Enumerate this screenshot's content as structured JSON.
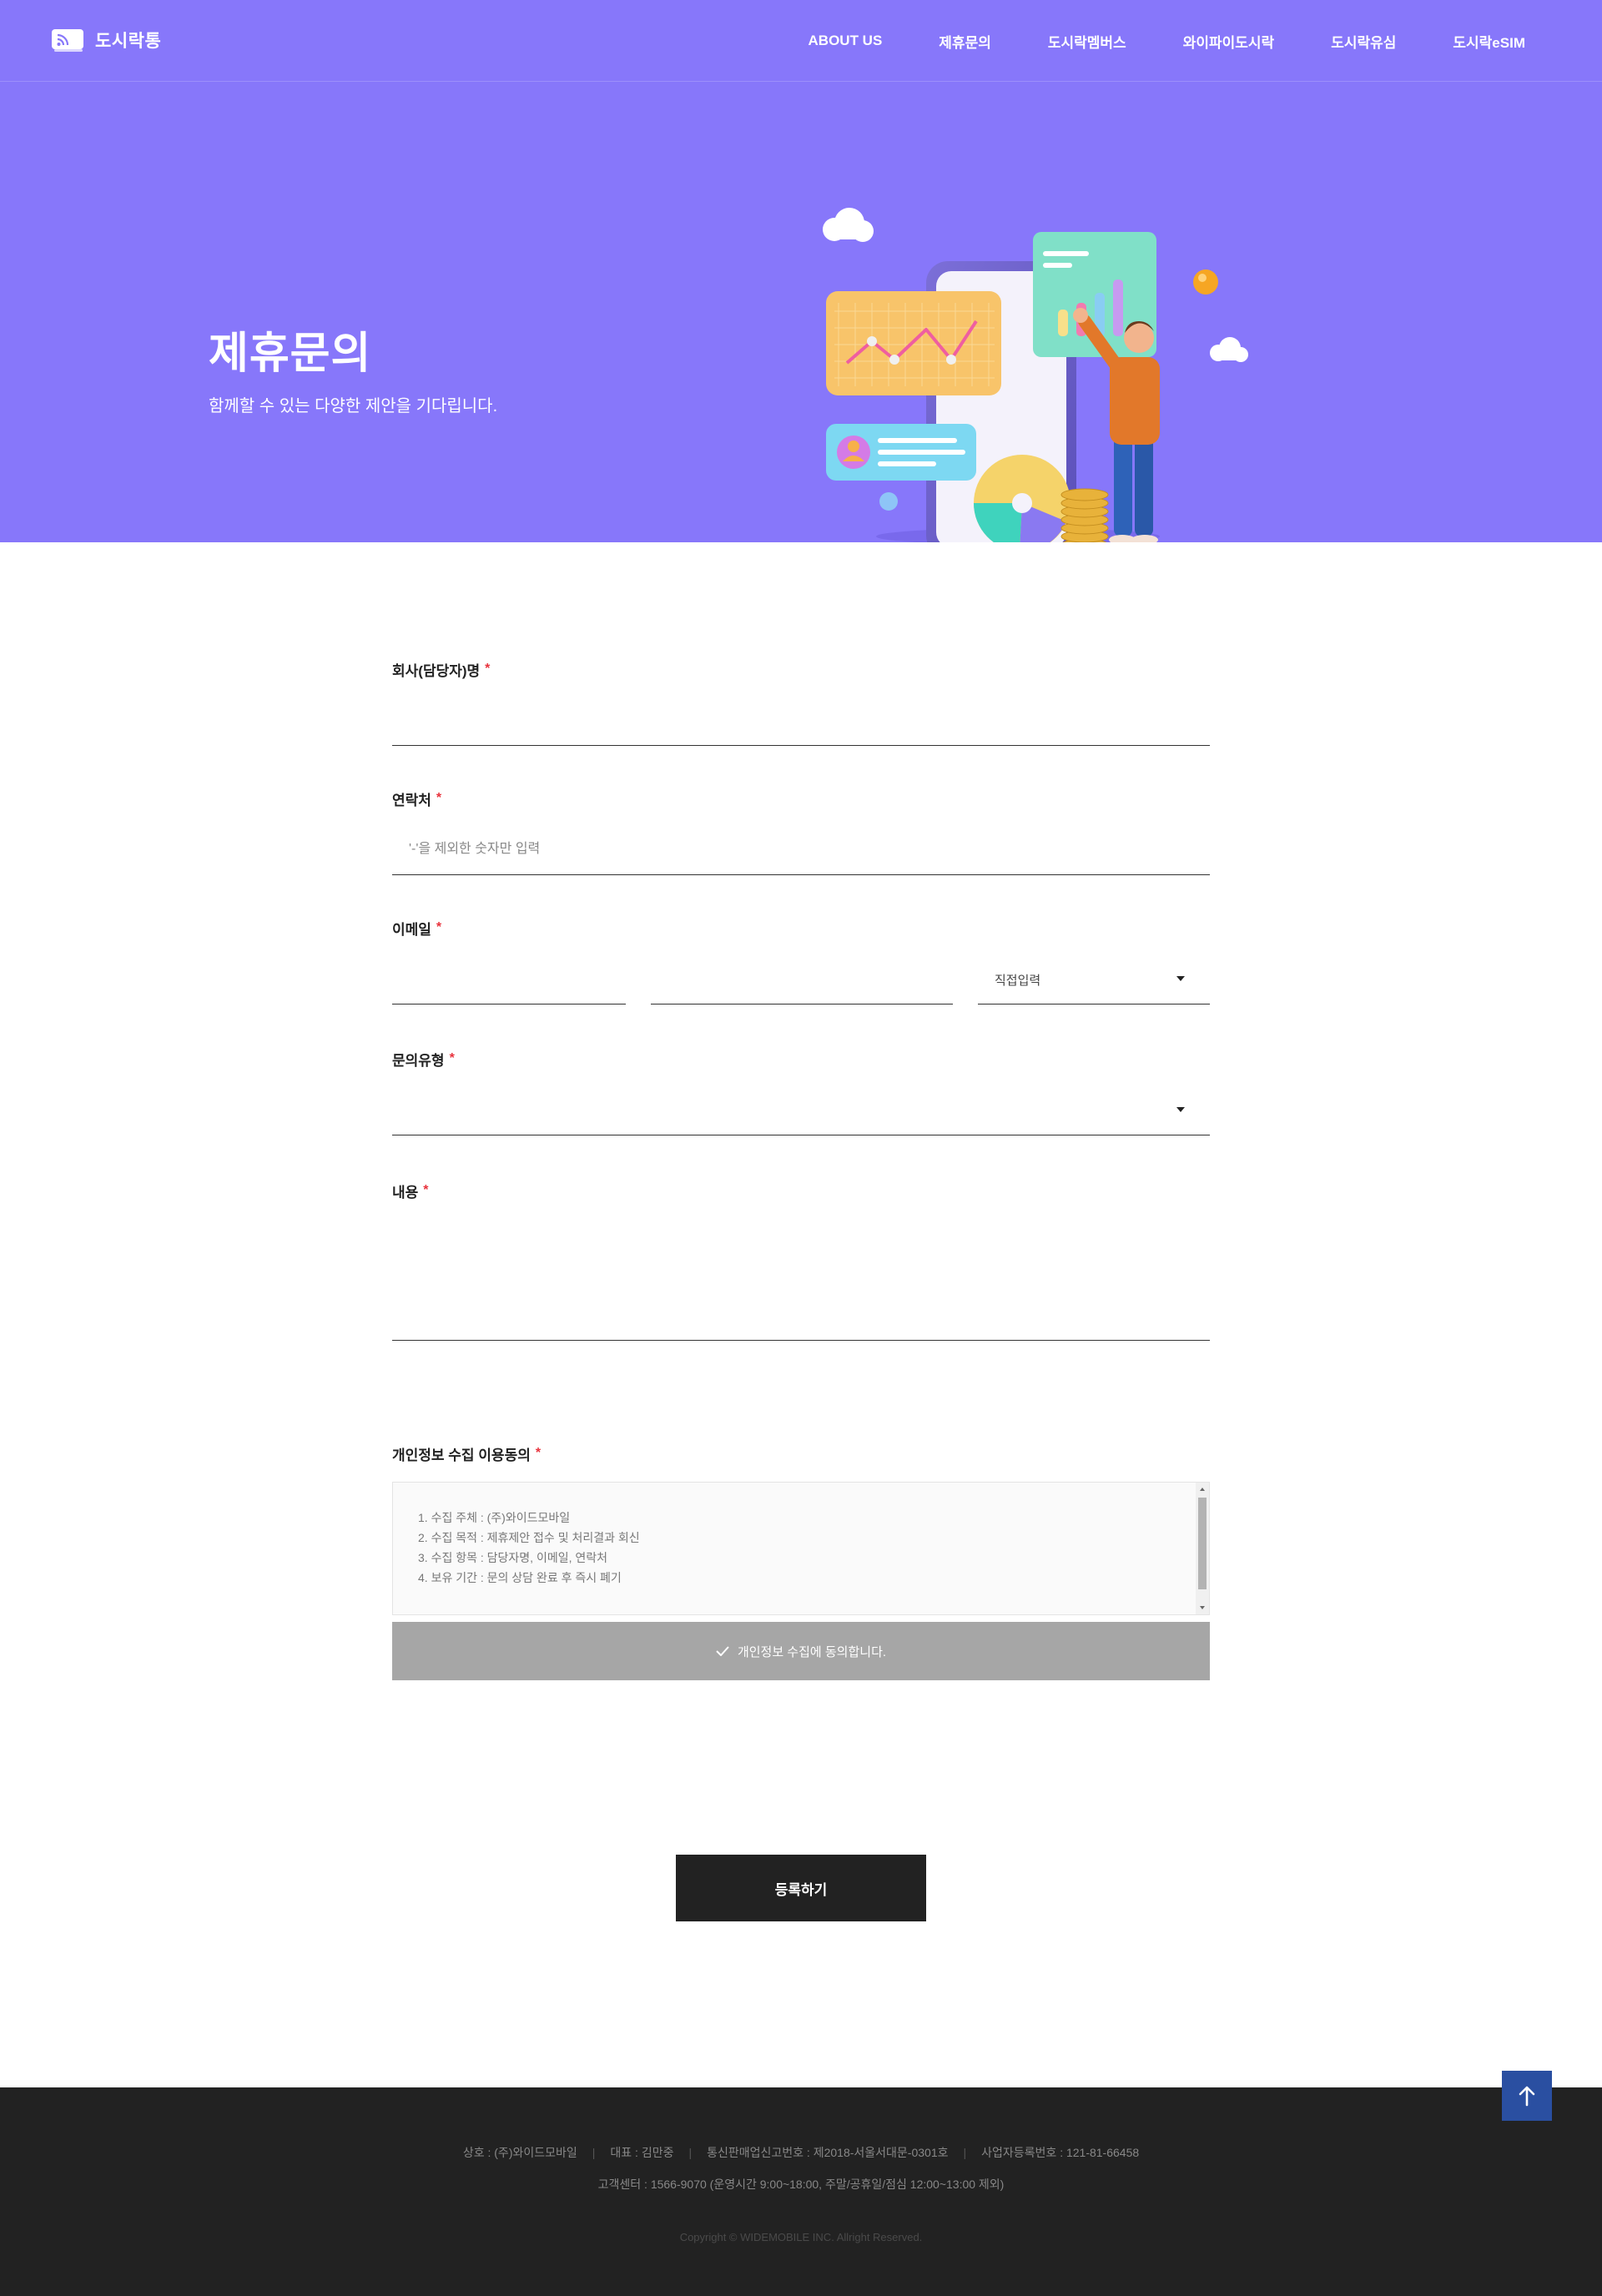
{
  "header": {
    "logo_text": "도시락통",
    "nav": [
      "ABOUT US",
      "제휴문의",
      "도시락멤버스",
      "와이파이도시락",
      "도시락유심",
      "도시락eSIM"
    ]
  },
  "hero": {
    "title": "제휴문의",
    "subtitle": "함께할 수 있는 다양한 제안을 기다립니다."
  },
  "form": {
    "company_label": "회사(담당자)명",
    "contact_label": "연락처",
    "contact_placeholder": "'-'을 제외한 숫자만 입력",
    "email_label": "이메일",
    "email_domain_select": "직접입력",
    "inquiry_type_label": "문의유형",
    "content_label": "내용",
    "privacy_label": "개인정보 수집 이용동의",
    "privacy_items": [
      "1. 수집 주체 : (주)와이드모바일",
      "2. 수집 목적 : 제휴제안 접수 및 처리결과 회신",
      "3. 수집 항목 : 담당자명, 이메일, 연락처",
      "4. 보유 기간 : 문의 상담 완료 후 즉시 폐기"
    ],
    "agree_label": "개인정보 수집에 동의합니다.",
    "submit_label": "등록하기",
    "required_mark": "*"
  },
  "footer": {
    "company": "상호 : (주)와이드모바일",
    "ceo": "대표 : 김만중",
    "telecom": "통신판매업신고번호 : 제2018-서울서대문-0301호",
    "business_no": "사업자등록번호 : 121-81-66458",
    "customer_center": "고객센터 : 1566-9070 (운영시간 9:00~18:00, 주말/공휴일/점심 12:00~13:00 제외)",
    "copyright": "Copyright © WIDEMOBILE INC. Allright Reserved."
  },
  "colors": {
    "brand_purple": "#8777fa",
    "required_red": "#e8323c",
    "agree_gray": "#a6a6a6",
    "footer_bg": "#222222",
    "top_button": "#2a4fa1"
  },
  "icons": {
    "logo": "router-logo-icon",
    "check": "check-icon",
    "caret": "caret-down-icon",
    "top": "arrow-up-icon"
  }
}
